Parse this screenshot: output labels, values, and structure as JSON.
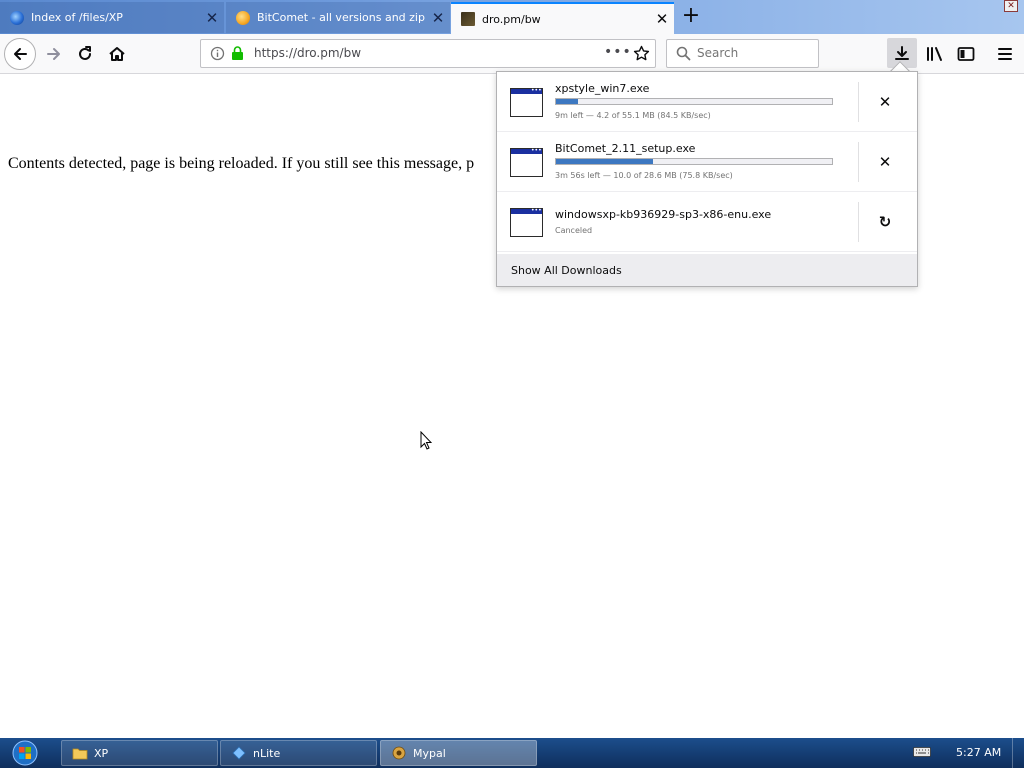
{
  "tabs": [
    {
      "title": "Index of /files/XP",
      "icon": "firefox-icon",
      "active": false
    },
    {
      "title": "BitComet - all versions and zip p",
      "icon": "bitcomet-icon",
      "active": false
    },
    {
      "title": "dro.pm/bw",
      "icon": "page-icon",
      "active": true
    }
  ],
  "navbar": {
    "url": "https://dro.pm/bw",
    "search_placeholder": "Search"
  },
  "page": {
    "message": "Contents detected, page is being reloaded. If you still see this message, p"
  },
  "downloads": {
    "items": [
      {
        "name": "xpstyle_win7.exe",
        "status": "9m left — 4.2 of 55.1 MB (84.5 KB/sec)",
        "progress_pct": 8,
        "action": "cancel-icon",
        "action_label": "✕"
      },
      {
        "name": "BitComet_2.11_setup.exe",
        "status": "3m 56s left — 10.0 of 28.6 MB (75.8 KB/sec)",
        "progress_pct": 35,
        "action": "cancel-icon",
        "action_label": "✕"
      },
      {
        "name": "windowsxp-kb936929-sp3-x86-enu.exe",
        "status": "Canceled",
        "action": "retry-icon",
        "action_label": "↻"
      }
    ],
    "footer": "Show All Downloads"
  },
  "taskbar": {
    "items": [
      {
        "label": "XP",
        "icon": "folder-icon",
        "active": false
      },
      {
        "label": "nLite",
        "icon": "nlite-icon",
        "active": false
      },
      {
        "label": "Mypal",
        "icon": "mypal-icon",
        "active": true
      }
    ],
    "clock": "5:27 AM"
  },
  "colors": {
    "accent": "#0a84ff",
    "progress": "#3d78c1",
    "taskbar": "#153e74"
  }
}
